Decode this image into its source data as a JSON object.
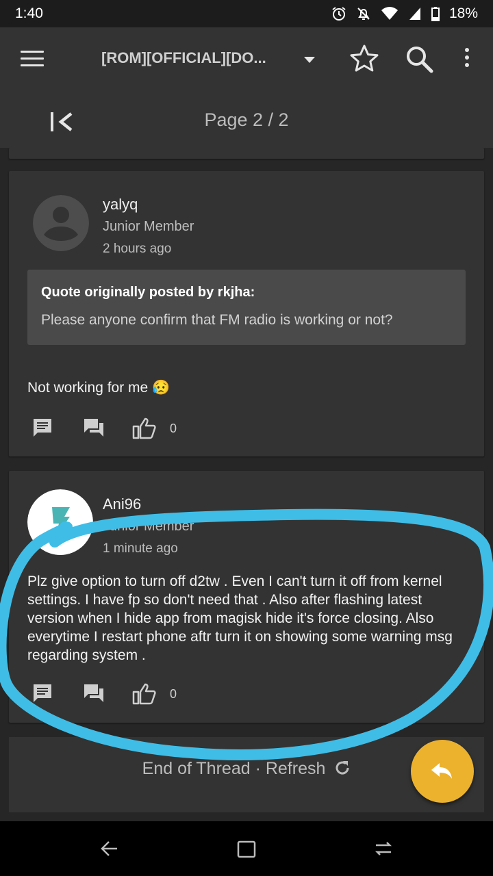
{
  "status_bar": {
    "time": "1:40",
    "battery": "18%"
  },
  "app_bar": {
    "thread_title": "[ROM][OFFICIAL][DO...",
    "page_indicator": "Page 2 / 2"
  },
  "posts": [
    {
      "username": "yalyq",
      "rank": "Junior Member",
      "time": "2 hours ago",
      "quote_author": "Quote originally posted by rkjha:",
      "quote_text": "Please anyone confirm that FM radio is working or not?",
      "body": "Not working for me",
      "emoji": "😥",
      "likes": "0"
    },
    {
      "username": "Ani96",
      "rank": "Junior Member",
      "time": "1 minute ago",
      "body": "Plz give option to turn off d2tw . Even I can't turn it off from kernel settings. I have fp so don't need that . Also after flashing latest version when I hide app from magisk hide it's force closing. Also everytime I restart phone aftr turn it on showing some warning msg regarding system .",
      "likes": "0"
    }
  ],
  "footer": {
    "end_text": "End of Thread · Refresh"
  },
  "colors": {
    "accent": "#ecb22e",
    "annotation": "#3fbde6",
    "card": "#333333",
    "background": "#262626"
  }
}
